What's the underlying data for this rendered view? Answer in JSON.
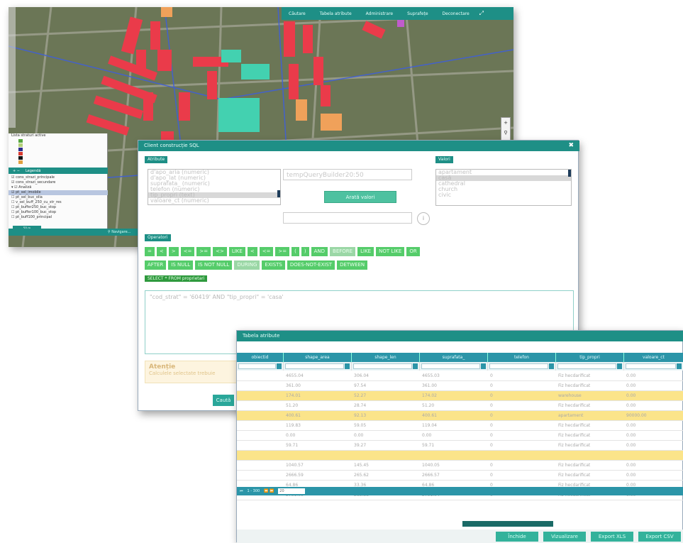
{
  "map": {
    "menu": [
      "Căutare",
      "Tabela atribute",
      "Administrare",
      "Suprafețe",
      "Deconectare"
    ],
    "status": "Navigare...",
    "left_panel": {
      "title": "Lista straturi active",
      "legend_label": "Legendă",
      "layers": [
        "cons_strazi_principale",
        "cons_strazi_secundare"
      ],
      "analysis_title": "Analiză",
      "analysis_layers": [
        "pt_sel_imobile",
        "pt_sel_buc_olia",
        "v_sel_buff_250_cu_str_res",
        "pt_buffer250_buc_stop",
        "pt_buffer100_buc_stop",
        "pt_buff100_principal"
      ],
      "selected_layer_index": 0,
      "scale": "50 m"
    }
  },
  "query_builder": {
    "title": "Client construcție SQL",
    "attributes_label": "Atribute",
    "attributes": [
      "d'apo_aria (numeric)",
      "d'apo_lat (numeric)",
      "suprafata_ (numeric)",
      "telefon (numeric)",
      "tip_propri (text)",
      "valoare_ct (numeric)"
    ],
    "selected_attribute_index": 4,
    "temp_name": "tempQueryBuilder20:50",
    "show_values_button": "Arată valori",
    "values_label": "Valori",
    "values": [
      "apartament",
      "casă",
      "cathedral",
      "church",
      "civic"
    ],
    "selected_value_index": 1,
    "info_button": "i",
    "operators_label": "Operatori",
    "operators_row1": [
      "=",
      "<",
      ">",
      "<=",
      ">=",
      "<>",
      "LIKE",
      "<",
      "<=",
      ">=",
      "(",
      ")",
      "AND",
      "BEFORE",
      "LIKE",
      "NOT LIKE",
      "OR"
    ],
    "operators_row2": [
      "AFTER",
      "IS NULL",
      "IS NOT NULL",
      "DURING",
      "EXISTS",
      "DOES-NOT-EXIST",
      "DETWEEN"
    ],
    "dim_ops": [
      "BEFORE",
      "DURING"
    ],
    "sql_prefix": "SELECT * FROM proprietari",
    "sql": "\"cod_strat\" = '60419' AND \"tip_propri\" = 'casa'",
    "warning_title": "Atenție",
    "warning_text": "Calculele selectate trebuie",
    "ok_button": "Caută"
  },
  "attribute_table": {
    "title": "Tabela atribute",
    "columns": [
      "obiectid",
      "shape_area",
      "shape_len",
      "suprafata_",
      "telefon",
      "tip_propri",
      "valoare_ct"
    ],
    "rows": [
      {
        "cells": [
          "",
          "4655.04",
          "306.04",
          "4655.03",
          "0",
          "Fiz hecdarificat",
          "0.00"
        ],
        "hl": false
      },
      {
        "cells": [
          "",
          "361.00",
          "97.54",
          "361.00",
          "0",
          "Fiz hecdarificat",
          "0.00"
        ],
        "hl": false
      },
      {
        "cells": [
          "",
          "174.01",
          "52.27",
          "174.02",
          "0",
          "warehouse",
          "0.00"
        ],
        "hl": true
      },
      {
        "cells": [
          "",
          "51.20",
          "28.74",
          "51.20",
          "0",
          "Fiz hecdarificat",
          "0.00"
        ],
        "hl": false
      },
      {
        "cells": [
          "",
          "400.61",
          "92.13",
          "400.61",
          "0",
          "apartament",
          "90000.00"
        ],
        "hl": true
      },
      {
        "cells": [
          "",
          "119.83",
          "59.05",
          "119.04",
          "0",
          "Fiz hecdarificat",
          "0.00"
        ],
        "hl": false
      },
      {
        "cells": [
          "",
          "0.00",
          "0.00",
          "0.00",
          "0",
          "Fiz hecdarificat",
          "0.00"
        ],
        "hl": false
      },
      {
        "cells": [
          "",
          "59.71",
          "39.27",
          "59.71",
          "0",
          "Fiz hecdarificat",
          "0.00"
        ],
        "hl": false
      },
      {
        "cells": [
          "",
          "",
          "",
          "",
          "",
          "",
          ""
        ],
        "hl": true
      },
      {
        "cells": [
          "",
          "1040.57",
          "145.45",
          "1040.05",
          "0",
          "Fiz hecdarificat",
          "0.00"
        ],
        "hl": false
      },
      {
        "cells": [
          "",
          "2666.59",
          "265.62",
          "2666.57",
          "0",
          "Fiz hecdarificat",
          "0.00"
        ],
        "hl": false
      },
      {
        "cells": [
          "",
          "64.86",
          "33.36",
          "64.86",
          "0",
          "Fiz hecdarificat",
          "0.00"
        ],
        "hl": false
      },
      {
        "cells": [
          "",
          "2751.03",
          "285.38",
          "2751.04",
          "0",
          "Fiz hecdarificat",
          "0.00"
        ],
        "hl": false
      }
    ],
    "pager_text": "1 - 300",
    "pager_select": "20",
    "footer_buttons": [
      "Închide",
      "Vizualizare",
      "Export XLS",
      "Export CSV"
    ]
  }
}
